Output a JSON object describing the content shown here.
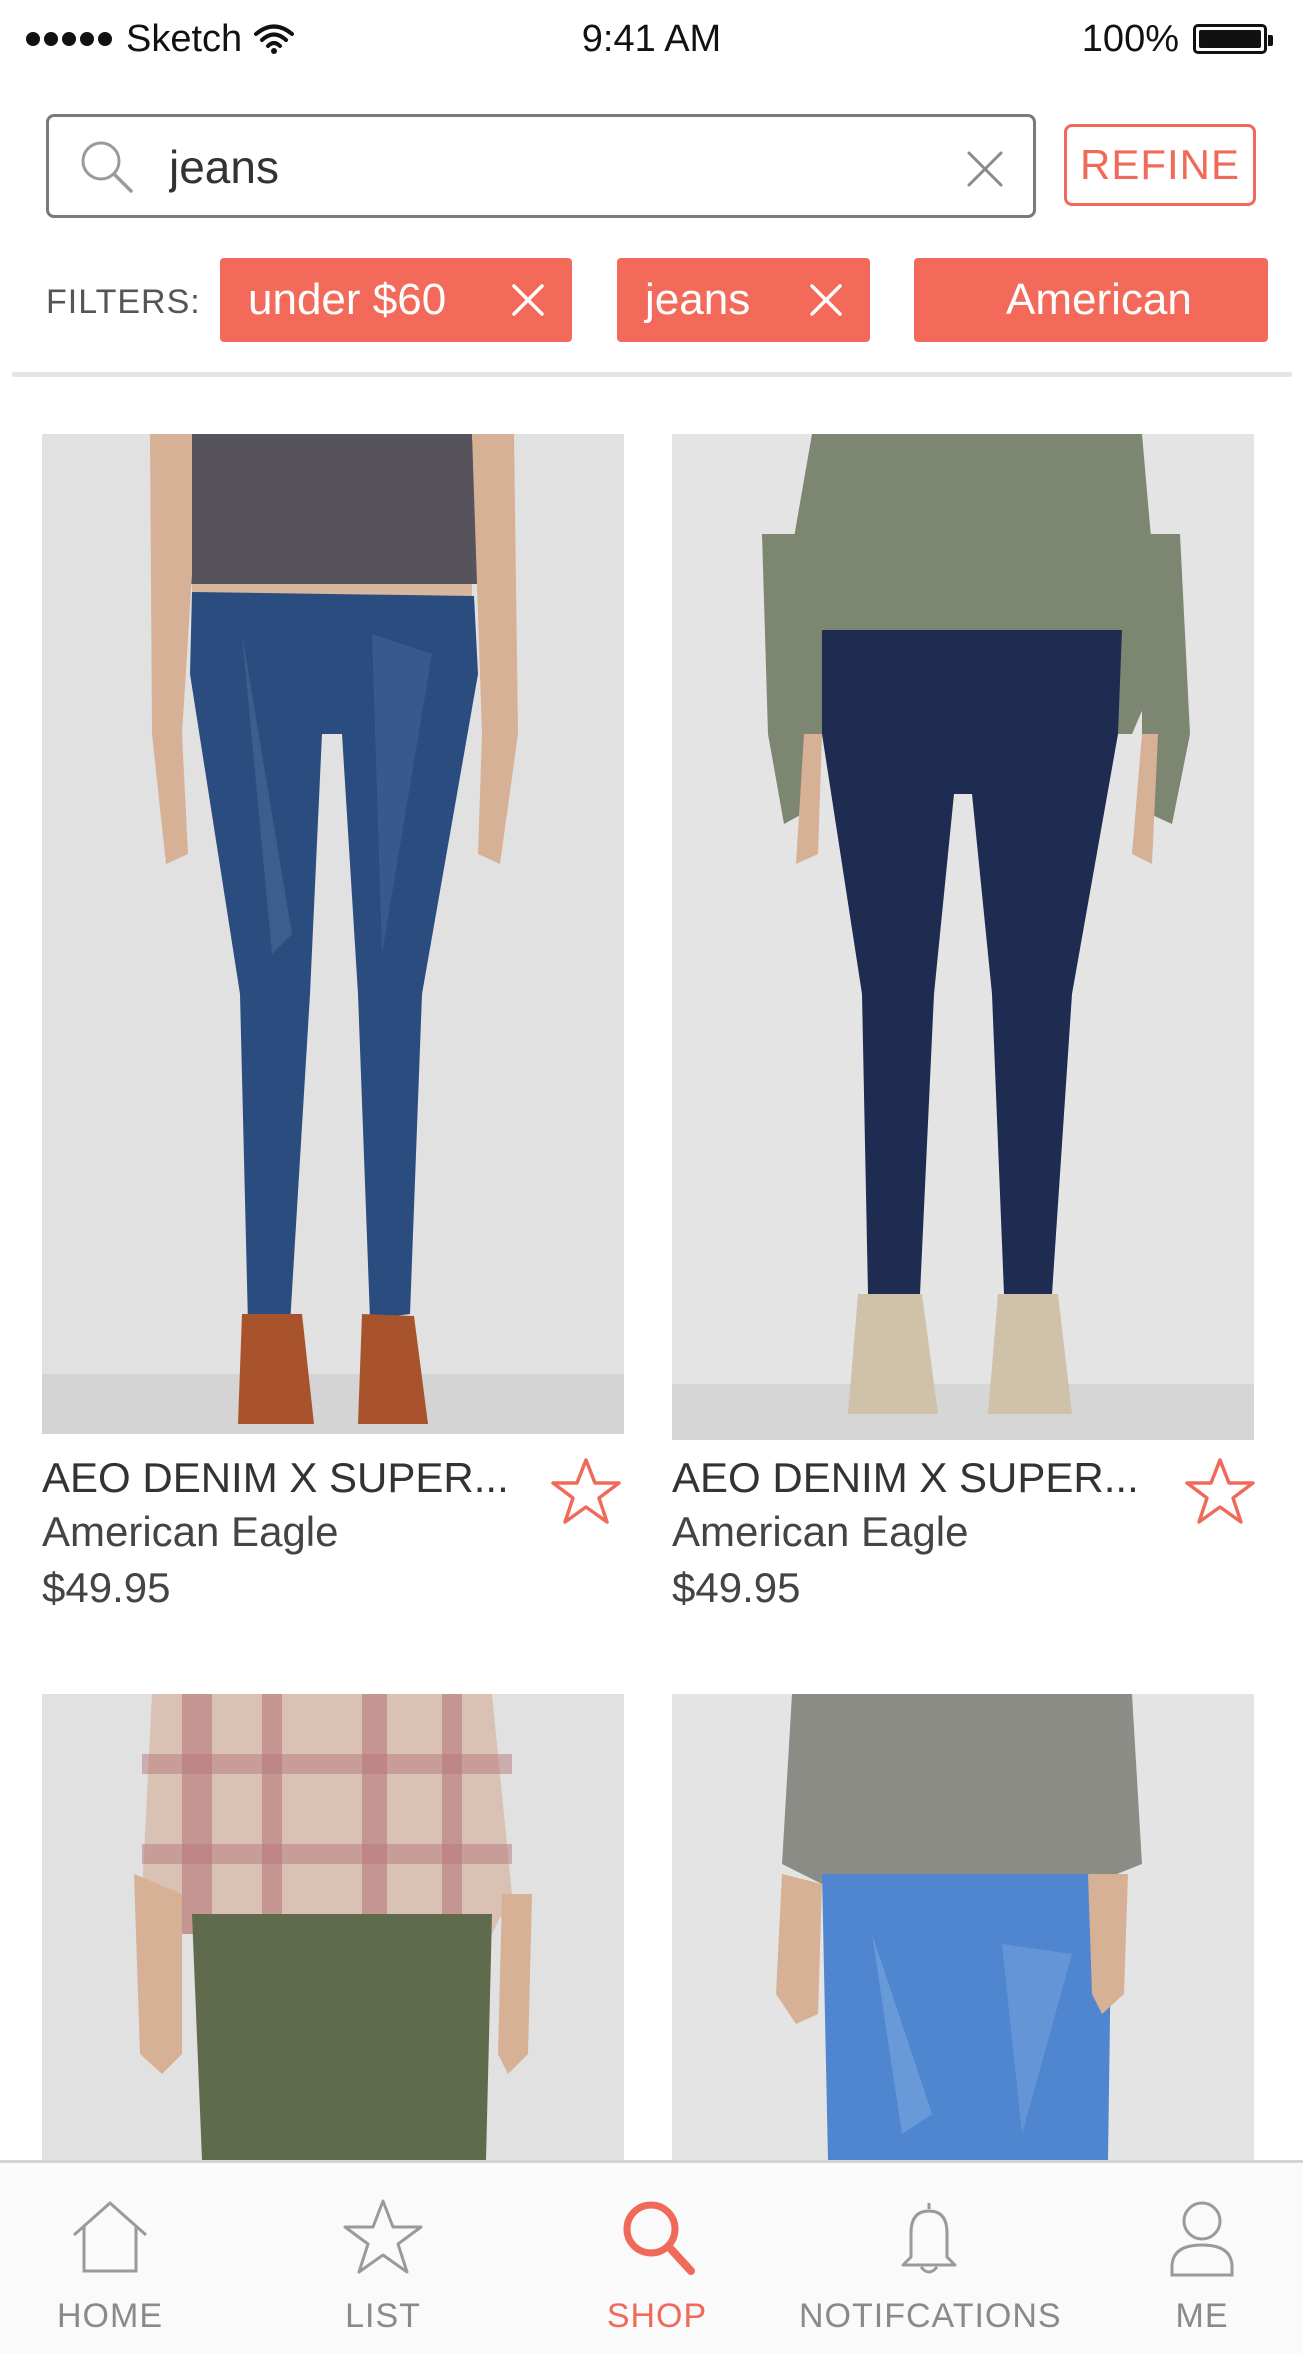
{
  "status_bar": {
    "carrier": "Sketch",
    "time": "9:41 AM",
    "battery": "100%",
    "battery_level": 1.0
  },
  "search": {
    "value": "jeans",
    "placeholder": "Search",
    "refine_label": "REFINE"
  },
  "filters": {
    "label": "FILTERS:",
    "chips": [
      {
        "label": "under $60"
      },
      {
        "label": "jeans"
      },
      {
        "label": "American"
      }
    ]
  },
  "products": [
    {
      "name": "AEO DENIM X SUPER...",
      "brand": "American Eagle",
      "price": "$49.95",
      "favorited": false
    },
    {
      "name": "AEO DENIM X SUPER...",
      "brand": "American Eagle",
      "price": "$49.95",
      "favorited": false
    },
    {
      "name": "",
      "brand": "",
      "price": "",
      "favorited": false
    },
    {
      "name": "",
      "brand": "",
      "price": "",
      "favorited": false
    }
  ],
  "tab_bar": {
    "tabs": [
      {
        "label": "HOME",
        "icon": "home-icon",
        "active": false
      },
      {
        "label": "LIST",
        "icon": "star-icon",
        "active": false
      },
      {
        "label": "SHOP",
        "icon": "search-icon",
        "active": true
      },
      {
        "label": "NOTIFCATIONS",
        "icon": "bell-icon",
        "active": false
      },
      {
        "label": "ME",
        "icon": "user-icon",
        "active": false
      }
    ]
  },
  "colors": {
    "accent": "#f06a5a",
    "chip_background": "#f36a5a",
    "tab_inactive": "#8a8a8a"
  }
}
